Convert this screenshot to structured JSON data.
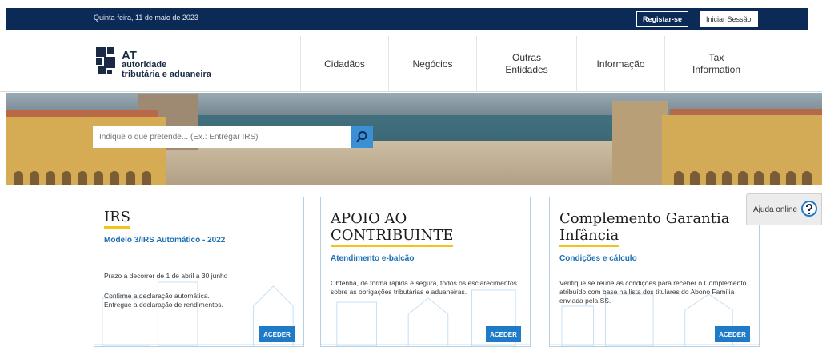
{
  "topbar": {
    "date": "Quinta-feira, 11 de maio de 2023",
    "register_label": "Registar-se",
    "login_label": "Iniciar Sessão",
    "background_color": "#0c2a56"
  },
  "logo": {
    "line1": "AT",
    "line2": "autoridade",
    "line3": "tributária e aduaneira"
  },
  "nav": {
    "items": [
      {
        "line1": "Cidadãos",
        "line2": ""
      },
      {
        "line1": "Negócios",
        "line2": ""
      },
      {
        "line1": "Outras",
        "line2": "Entidades"
      },
      {
        "line1": "Informação",
        "line2": ""
      },
      {
        "line1": "Tax",
        "line2": "Information"
      }
    ]
  },
  "search": {
    "placeholder": "Indique o que pretende... (Ex.: Entregar IRS)",
    "icon": "search-icon",
    "button_color": "#3a8fd5"
  },
  "cards": [
    {
      "title_line1": "IRS",
      "title_line2": "",
      "subtitle": "Modelo 3/IRS Automático - 2022",
      "text1": "Prazo a decorrer de 1 de abril a 30 junho",
      "text2": "Confirme a declaração automática.",
      "text3": "Entregue a declaração de rendimentos.",
      "button": "ACEDER"
    },
    {
      "title_line1": "APOIO AO",
      "title_line2": "CONTRIBUINTE",
      "subtitle": "Atendimento e-balcão",
      "text1": "Obtenha, de forma rápida e segura, todos os esclarecimentos sobre as obrigações tributárias e aduaneiras.",
      "button": "ACEDER"
    },
    {
      "title_line1": "Complemento Garantia",
      "title_line2": "Infância",
      "subtitle": "Condições e cálculo",
      "text1": "Verifique se reúne as condições para receber o Complemento atribuído com base na lista dos titulares do Abono Família enviada pela SS.",
      "button": "ACEDER"
    }
  ],
  "help": {
    "label": "Ajuda online",
    "icon": "question-chat-icon"
  },
  "colors": {
    "accent_blue": "#1f7ac8",
    "title_underline": "#f2c31a",
    "subtitle_blue": "#1b6fb5"
  }
}
